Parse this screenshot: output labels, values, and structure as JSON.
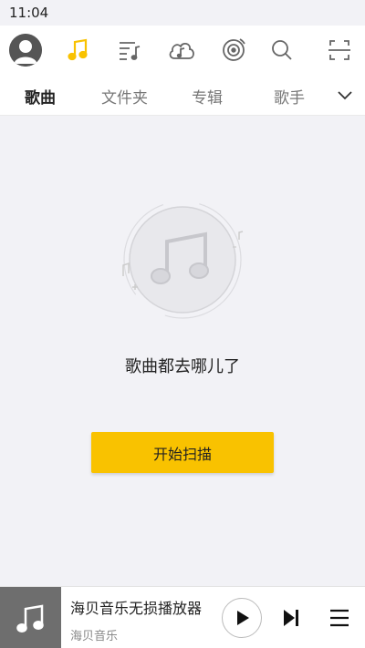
{
  "status_bar": {
    "time": "11:04"
  },
  "topbar": {
    "icons": [
      "avatar",
      "music-note-icon",
      "playlist-icon",
      "cloud-music-icon",
      "radio-disc-icon",
      "search-icon",
      "scan-icon"
    ],
    "active_color": "#f9c200"
  },
  "tabs": [
    {
      "label": "歌曲",
      "active": true
    },
    {
      "label": "文件夹",
      "active": false
    },
    {
      "label": "专辑",
      "active": false
    },
    {
      "label": "歌手",
      "active": false
    }
  ],
  "empty_state": {
    "message": "歌曲都去哪儿了",
    "button_label": "开始扫描"
  },
  "player": {
    "title": "海贝音乐无损播放器",
    "artist": "海贝音乐"
  },
  "colors": {
    "accent": "#f9c200",
    "background": "#f2f2f6"
  }
}
